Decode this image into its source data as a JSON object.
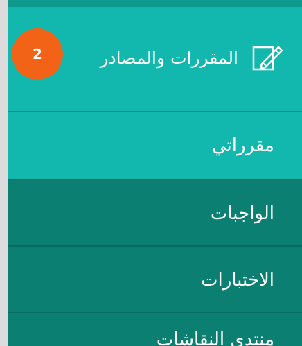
{
  "menu": {
    "header": {
      "label": "المقررات والمصادر",
      "badge_count": "2",
      "icon": "edit-icon"
    },
    "items": [
      {
        "label": "مقرراتي",
        "state": "active"
      },
      {
        "label": "الواجبات",
        "state": "normal"
      },
      {
        "label": "الاختبارات",
        "state": "normal"
      },
      {
        "label": "منتدى النقاشات",
        "state": "partially-visible"
      }
    ]
  },
  "colors": {
    "header_teal": "#12b8ad",
    "item_dark_teal": "#0b7f72",
    "badge_orange": "#f26318",
    "text": "#ffffff"
  }
}
